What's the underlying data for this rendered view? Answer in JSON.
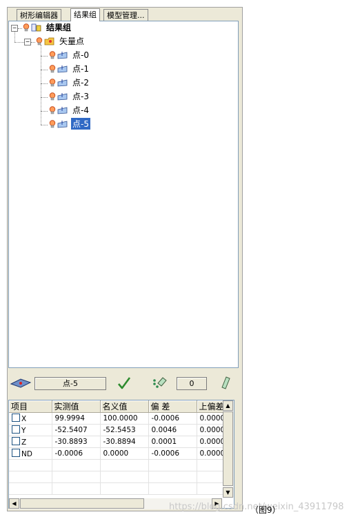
{
  "tabs": [
    {
      "label": "树形编辑器"
    },
    {
      "label": "结果组"
    },
    {
      "label": "模型管理..."
    }
  ],
  "tree": {
    "root": {
      "label": "结果组",
      "expander": "−"
    },
    "group": {
      "label": "矢量点",
      "expander": "−"
    },
    "points": [
      {
        "label": "点-0"
      },
      {
        "label": "点-1"
      },
      {
        "label": "点-2"
      },
      {
        "label": "点-3"
      },
      {
        "label": "点-4"
      },
      {
        "label": "点-5",
        "selected": true
      }
    ]
  },
  "toolbar": {
    "current_point": "点-5",
    "count_value": "0"
  },
  "grid": {
    "columns": [
      "项目",
      "实测值",
      "名义值",
      "偏 差",
      "上偏差"
    ],
    "rows": [
      {
        "item": "X",
        "measured": "99.9994",
        "nominal": "100.0000",
        "deviation": "-0.0006",
        "upper": "0.0000"
      },
      {
        "item": "Y",
        "measured": "-52.5407",
        "nominal": "-52.5453",
        "deviation": "0.0046",
        "upper": "0.0000"
      },
      {
        "item": "Z",
        "measured": "-30.8893",
        "nominal": "-30.8894",
        "deviation": "0.0001",
        "upper": "0.0000"
      },
      {
        "item": "ND",
        "measured": "-0.0006",
        "nominal": "0.0000",
        "deviation": "-0.0006",
        "upper": "0.0000"
      }
    ]
  },
  "caption": "（图9）",
  "watermark": "https://blog.csdn.net/weixin_43911798",
  "colors": {
    "selection": "#316ac5",
    "panel": "#ece9d8",
    "check": "#2e8b2e"
  }
}
